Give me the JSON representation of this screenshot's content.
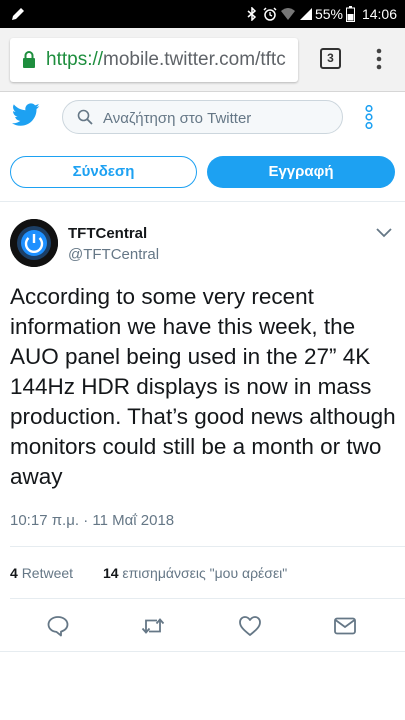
{
  "status_bar": {
    "battery": "55%",
    "time": "14:06"
  },
  "browser": {
    "url_scheme": "https://",
    "url_rest": "mobile.twitter.com/tftc",
    "tabs_count": "3"
  },
  "header": {
    "search_placeholder": "Αναζήτηση στο Twitter"
  },
  "auth": {
    "login_label": "Σύνδεση",
    "signup_label": "Εγγραφή"
  },
  "tweet": {
    "author_name": "TFTCentral",
    "author_handle": "@TFTCentral",
    "text": "According to some very recent information we have this week, the AUO panel being used in the 27” 4K 144Hz HDR displays is now in mass production. That’s good news although monitors could still be a month or two away",
    "timestamp": "10:17 π.μ. · 11 Μαΐ 2018",
    "retweet_count": "4",
    "retweet_label": "Retweet",
    "like_count": "14",
    "like_label": "επισημάνσεις \"μου αρέσει\""
  },
  "colors": {
    "brand": "#1da1f2",
    "text_primary": "#14171a",
    "text_secondary": "#657786",
    "secure_green": "#1e8e3e"
  },
  "icons": [
    "edit-icon",
    "bluetooth-icon",
    "alarm-icon",
    "wifi-icon",
    "signal-icon",
    "battery-icon",
    "lock-icon",
    "tabs-icon",
    "menu-dots-icon",
    "twitter-logo-icon",
    "search-icon",
    "more-icon",
    "chevron-down-icon",
    "reply-icon",
    "retweet-icon",
    "like-icon",
    "message-icon"
  ]
}
